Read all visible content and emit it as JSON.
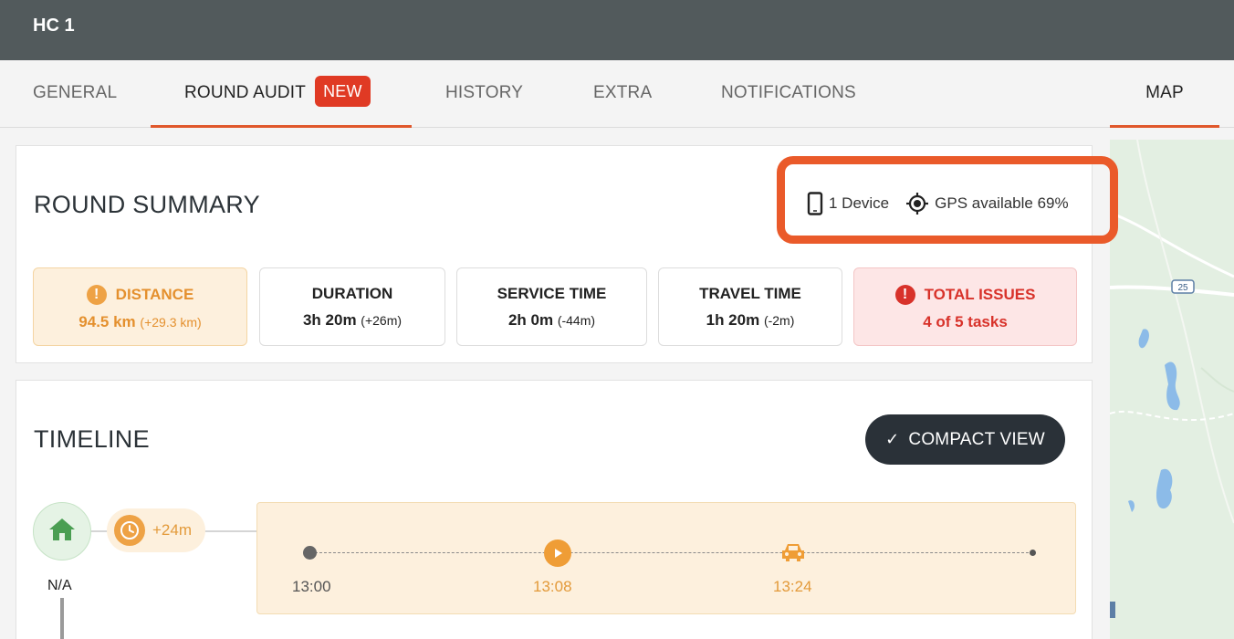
{
  "app": {
    "title": "HC 1"
  },
  "tabs": [
    {
      "label": "GENERAL"
    },
    {
      "label": "ROUND AUDIT",
      "badge": "NEW"
    },
    {
      "label": "HISTORY"
    },
    {
      "label": "EXTRA"
    },
    {
      "label": "NOTIFICATIONS"
    },
    {
      "label": "MAP"
    }
  ],
  "active_tabs": [
    "ROUND AUDIT",
    "MAP"
  ],
  "summary": {
    "title": "ROUND SUMMARY",
    "devices": "1 Device",
    "gps": "GPS available 69%",
    "stats": [
      {
        "label": "DISTANCE",
        "value": "94.5 km",
        "delta": "(+29.3 km)",
        "status": "warning"
      },
      {
        "label": "DURATION",
        "value": "3h 20m",
        "delta": "(+26m)",
        "status": "normal"
      },
      {
        "label": "SERVICE TIME",
        "value": "2h 0m",
        "delta": "(-44m)",
        "status": "normal"
      },
      {
        "label": "TRAVEL TIME",
        "value": "1h 20m",
        "delta": "(-2m)",
        "status": "normal"
      },
      {
        "label": "TOTAL ISSUES",
        "value": "4 of 5 tasks",
        "delta": "",
        "status": "error"
      }
    ]
  },
  "timeline": {
    "title": "TIMELINE",
    "compact_view_label": "COMPACT VIEW",
    "start_label": "N/A",
    "delay": "+24m",
    "times": [
      "13:00",
      "13:08",
      "13:24"
    ]
  },
  "colors": {
    "accent": "#e0572b",
    "header": "#525a5c",
    "warning": "#e4902e",
    "error": "#d8322a",
    "dark_button": "#2a3138"
  },
  "icons": {
    "device": "phone-icon",
    "gps": "gps-target-icon",
    "warning": "exclamation-circle-icon",
    "error": "exclamation-circle-icon",
    "home": "home-icon",
    "delay": "clock-icon",
    "play": "play-icon",
    "travel": "car-icon",
    "check": "check-icon"
  }
}
